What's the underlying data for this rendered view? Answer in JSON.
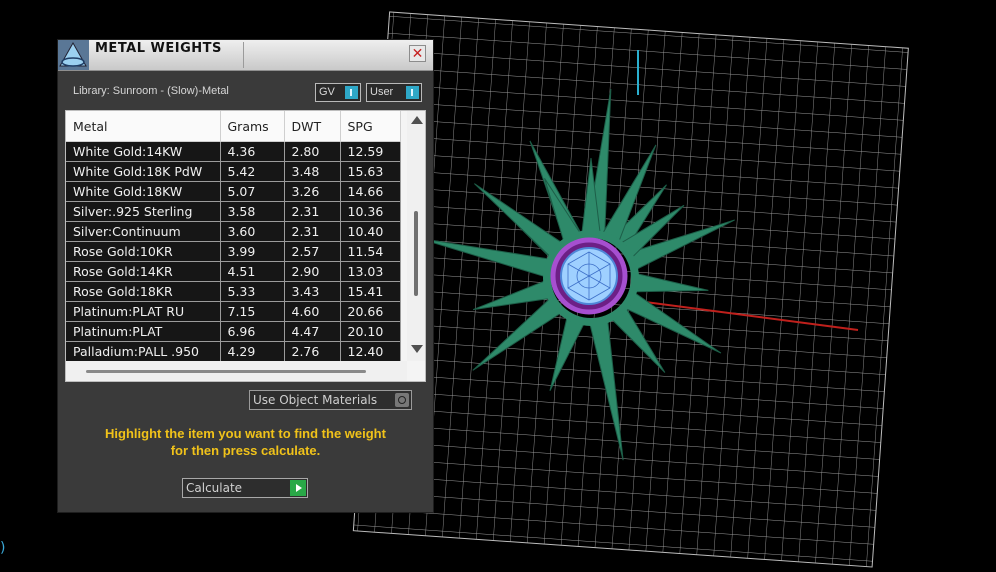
{
  "window": {
    "title": "METAL WEIGHTS",
    "close_glyph": "✕"
  },
  "library": {
    "label": "Library: Sunroom - (Slow)-Metal",
    "gv_toggle": "GV",
    "user_toggle": "User"
  },
  "table": {
    "columns": [
      "Metal",
      "Grams",
      "DWT",
      "SPG"
    ],
    "rows": [
      {
        "metal": "White Gold:14KW",
        "grams": "4.36",
        "dwt": "2.80",
        "spg": "12.59"
      },
      {
        "metal": "White Gold:18K PdW",
        "grams": "5.42",
        "dwt": "3.48",
        "spg": "15.63"
      },
      {
        "metal": "White Gold:18KW",
        "grams": "5.07",
        "dwt": "3.26",
        "spg": "14.66"
      },
      {
        "metal": "Silver:.925 Sterling",
        "grams": "3.58",
        "dwt": "2.31",
        "spg": "10.36"
      },
      {
        "metal": "Silver:Continuum",
        "grams": "3.60",
        "dwt": "2.31",
        "spg": "10.40"
      },
      {
        "metal": "Rose Gold:10KR",
        "grams": "3.99",
        "dwt": "2.57",
        "spg": "11.54"
      },
      {
        "metal": "Rose Gold:14KR",
        "grams": "4.51",
        "dwt": "2.90",
        "spg": "13.03"
      },
      {
        "metal": "Rose Gold:18KR",
        "grams": "5.33",
        "dwt": "3.43",
        "spg": "15.41"
      },
      {
        "metal": "Platinum:PLAT RU",
        "grams": "7.15",
        "dwt": "4.60",
        "spg": "20.66"
      },
      {
        "metal": "Platinum:PLAT",
        "grams": "6.96",
        "dwt": "4.47",
        "spg": "20.10"
      },
      {
        "metal": "Palladium:PALL .950",
        "grams": "4.29",
        "dwt": "2.76",
        "spg": "12.40"
      }
    ]
  },
  "options": {
    "use_object_materials": "Use Object Materials"
  },
  "hint": {
    "line1": "Highlight the item you want to find the weight",
    "line2": "for then press calculate."
  },
  "actions": {
    "calculate": "Calculate"
  },
  "colors": {
    "accent": "#2ea8c8",
    "hint_text": "#f0c21a",
    "model_green": "#2e8a6a",
    "model_purple": "#8a2fa6",
    "x_axis": "#c0201c",
    "y_axis": "#2ab0d0"
  }
}
